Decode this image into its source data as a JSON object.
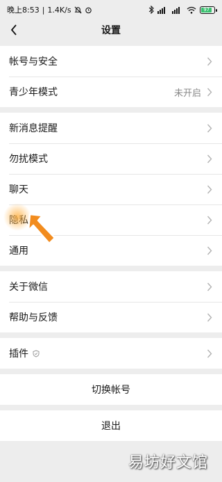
{
  "status": {
    "time": "晚上8:53",
    "speed": "1.4K/s",
    "battery": "97"
  },
  "header": {
    "title": "设置"
  },
  "groups": [
    {
      "items": [
        {
          "label": "帐号与安全"
        },
        {
          "label": "青少年模式",
          "value": "未开启"
        }
      ]
    },
    {
      "items": [
        {
          "label": "新消息提醒"
        },
        {
          "label": "勿扰模式"
        },
        {
          "label": "聊天"
        },
        {
          "label": "隐私"
        },
        {
          "label": "通用"
        }
      ]
    },
    {
      "items": [
        {
          "label": "关于微信"
        },
        {
          "label": "帮助与反馈"
        }
      ]
    },
    {
      "items": [
        {
          "label": "插件"
        }
      ]
    }
  ],
  "actions": {
    "switch_account": "切换帐号",
    "logout": "退出"
  },
  "watermark": "易坊好文馆",
  "colors": {
    "background": "#ededed",
    "cursor": "#f28c1e"
  }
}
